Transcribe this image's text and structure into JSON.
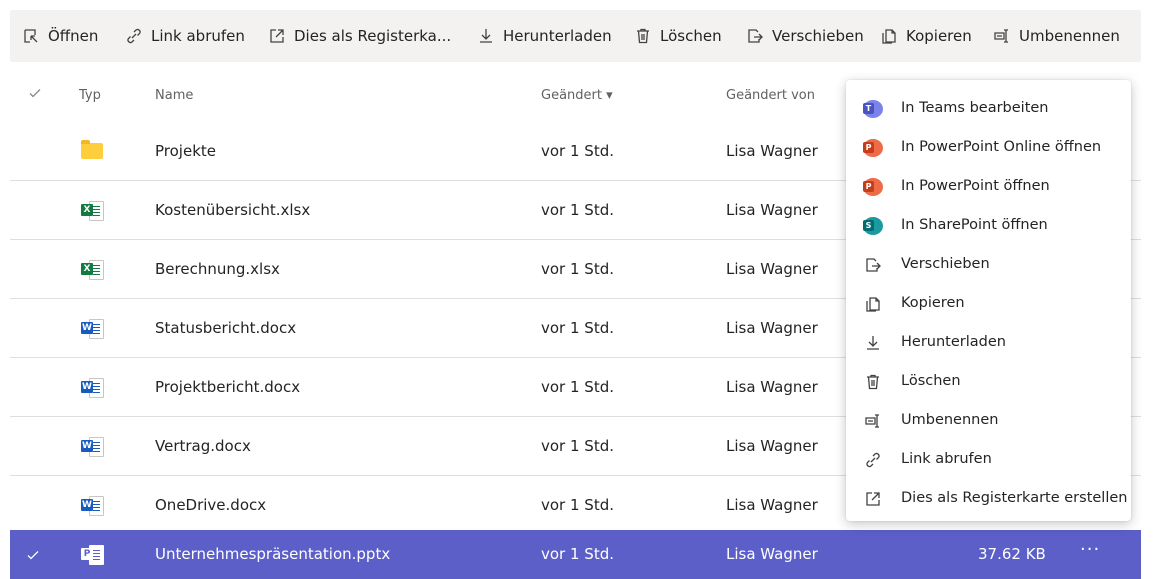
{
  "toolbar": {
    "items": [
      {
        "label": "Öffnen",
        "icon": "open-icon"
      },
      {
        "label": "Link abrufen",
        "icon": "link-icon"
      },
      {
        "label": "Dies als Registerka...",
        "icon": "tab-icon"
      },
      {
        "label": "Herunterladen",
        "icon": "download-icon"
      },
      {
        "label": "Löschen",
        "icon": "trash-icon"
      },
      {
        "label": "Verschieben",
        "icon": "move-icon"
      },
      {
        "label": "Kopieren",
        "icon": "copy-icon"
      },
      {
        "label": "Umbenennen",
        "icon": "rename-icon"
      }
    ]
  },
  "columns": {
    "type": "Typ",
    "name": "Name",
    "modified": "Geändert ▾",
    "modified_by": "Geändert von"
  },
  "files": [
    {
      "type": "folder",
      "name": "Projekte",
      "modified": "vor 1 Std.",
      "modified_by": "Lisa Wagner"
    },
    {
      "type": "excel",
      "name": "Kostenübersicht.xlsx",
      "modified": "vor 1 Std.",
      "modified_by": "Lisa Wagner"
    },
    {
      "type": "excel",
      "name": "Berechnung.xlsx",
      "modified": "vor 1 Std.",
      "modified_by": "Lisa Wagner"
    },
    {
      "type": "word",
      "name": "Statusbericht.docx",
      "modified": "vor 1 Std.",
      "modified_by": "Lisa Wagner"
    },
    {
      "type": "word",
      "name": "Projektbericht.docx",
      "modified": "vor 1 Std.",
      "modified_by": "Lisa Wagner"
    },
    {
      "type": "word",
      "name": "Vertrag.docx",
      "modified": "vor 1 Std.",
      "modified_by": "Lisa Wagner"
    },
    {
      "type": "word",
      "name": "OneDrive.docx",
      "modified": "vor 1 Std.",
      "modified_by": "Lisa Wagner"
    },
    {
      "type": "powerpoint",
      "name": "Unternehmespräsentation.pptx",
      "modified": "vor 1 Std.",
      "modified_by": "Lisa Wagner",
      "size": "37.62 KB",
      "more": "···",
      "selected": true
    }
  ],
  "context_menu": [
    {
      "label": "In Teams bearbeiten",
      "icon": "teams-icon"
    },
    {
      "label": "In PowerPoint Online öffnen",
      "icon": "powerpoint-icon"
    },
    {
      "label": "In PowerPoint öffnen",
      "icon": "powerpoint-icon"
    },
    {
      "label": "In SharePoint öffnen",
      "icon": "sharepoint-icon"
    },
    {
      "label": "Verschieben",
      "icon": "move-icon"
    },
    {
      "label": "Kopieren",
      "icon": "copy-icon"
    },
    {
      "label": "Herunterladen",
      "icon": "download-icon"
    },
    {
      "label": "Löschen",
      "icon": "trash-icon"
    },
    {
      "label": "Umbenennen",
      "icon": "rename-icon"
    },
    {
      "label": "Link abrufen",
      "icon": "link-icon"
    },
    {
      "label": "Dies als Registerkarte erstellen",
      "icon": "tab-icon"
    }
  ],
  "colors": {
    "selected_row": "#5b5fc7",
    "teams": "#5b5fc7",
    "powerpoint": "#c43e1c",
    "sharepoint": "#038387",
    "excel": "#107c41",
    "word": "#185abd"
  }
}
